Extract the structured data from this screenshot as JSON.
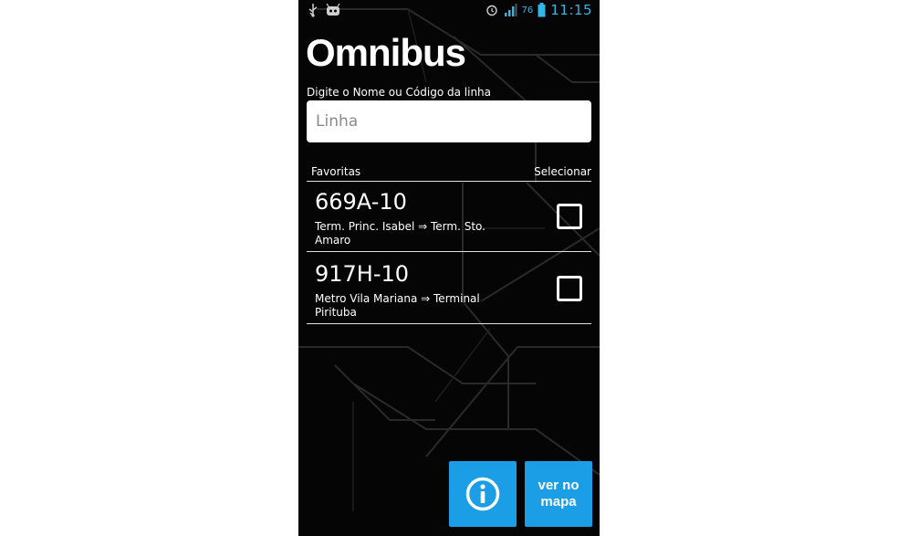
{
  "status_bar": {
    "left_icons": [
      "usb-icon",
      "android-debug-icon"
    ],
    "right_icons": [
      "alarm-icon",
      "signal-3g-icon",
      "battery-icon"
    ],
    "battery_level": "76",
    "time": "11:15"
  },
  "app": {
    "title": "Omnibus"
  },
  "search": {
    "label": "Digite o Nome ou Código da linha",
    "placeholder": "Linha",
    "value": ""
  },
  "favorites": {
    "header_left": "Favoritas",
    "header_right": "Selecionar",
    "items": [
      {
        "code": "669A-10",
        "route": "Term. Princ. Isabel ⇒ Term. Sto. Amaro",
        "checked": false
      },
      {
        "code": "917H-10",
        "route": "Metro Vila Mariana ⇒ Terminal Pirituba",
        "checked": false
      }
    ]
  },
  "buttons": {
    "info_icon": "info-icon",
    "map_label": "ver no mapa"
  },
  "colors": {
    "accent": "#1b9ee6",
    "status_accent": "#33b5e5",
    "background": "#050505"
  }
}
